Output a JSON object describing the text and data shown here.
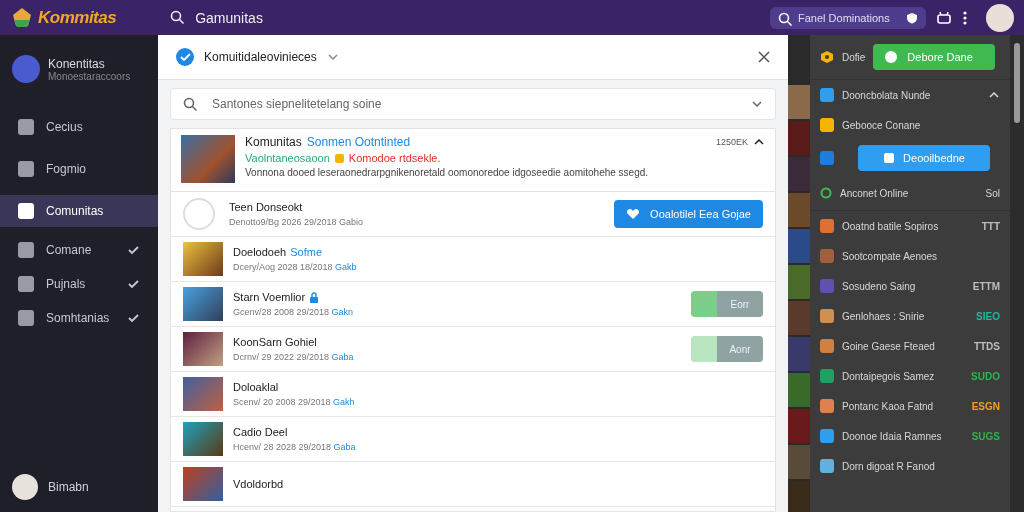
{
  "topbar": {
    "logo": "Kommitas",
    "search": "Gamunitas",
    "quick_search": {
      "placeholder": "Fanel Dominations"
    }
  },
  "sidebar": {
    "profile": {
      "name": "Konentitas",
      "subtitle": "Monoestaraccoors"
    },
    "items": [
      {
        "label": "Cecius",
        "kind": "link",
        "selected": false
      },
      {
        "label": "Fogmio",
        "kind": "link",
        "selected": false
      },
      {
        "label": "Comunitas",
        "kind": "link",
        "selected": true
      },
      {
        "label": "Comane",
        "kind": "group",
        "selected": false
      },
      {
        "label": "Pujnals",
        "kind": "group",
        "selected": false
      },
      {
        "label": "Somhtanias",
        "kind": "group",
        "selected": false
      }
    ],
    "user": "Bimabn"
  },
  "modal": {
    "title": "Komuitidaleovinieces",
    "search": "Santones siepnelitetelang soine",
    "featured": {
      "title": "Komunitas",
      "tag": "Sonmen Ootntinted",
      "status": "Vaolntaneosaoon",
      "warning": "Komodoe rtdsekle.",
      "description": "Vonnona dooed leseraonedrarpgnikenoretald oomonoredoe idgoseedie aomitohehe ssegd.",
      "count": "1250EK",
      "expanded": true
    },
    "rows": [
      {
        "name": "Teen Donseokt",
        "locked": false,
        "subtitle": "Denotto9/Bg 2026 29/2018 Gabio",
        "action": {
          "kind": "primary",
          "label": "Ooalotilel Eea Gojae"
        }
      },
      {
        "name": "Doelodoeh",
        "highlight": "Sofme",
        "locked": false,
        "subtitle": "Dcery/Aog 2028 18/2018",
        "link": "Gakb",
        "action": {
          "kind": "none"
        }
      },
      {
        "name": "Starn Voemlior",
        "locked": true,
        "subtitle": "Gcenv/28 2008 29/2018",
        "link": "Gakn",
        "action": {
          "kind": "toggle",
          "label": "Eorr",
          "on": true
        }
      },
      {
        "name": "KoonSarn Gohiel",
        "locked": false,
        "subtitle": "Dcrnv/ 29 2022 29/2018",
        "link": "Gaba",
        "action": {
          "kind": "toggle",
          "label": "Aonr",
          "on": false
        }
      },
      {
        "name": "Doloaklal",
        "locked": false,
        "subtitle": "Scenv/ 20 2008 29/2018",
        "link": "Gakh",
        "action": {
          "kind": "none"
        }
      },
      {
        "name": "Cadio Deel",
        "locked": false,
        "subtitle": "Hcenv/ 28 2028 29/2018",
        "link": "Gaba",
        "action": {
          "kind": "none"
        }
      },
      {
        "name": "Vdoldorbd",
        "locked": false,
        "action": {
          "kind": "none"
        }
      }
    ]
  },
  "panel": {
    "status_label": "Dofie",
    "status_button": "Debore Dane",
    "section": {
      "title": "Dooncbolata Nunde",
      "expanded": true
    },
    "subsection": "Gebooce Conane",
    "action_button": "Deooilbedne",
    "online": {
      "label": "Anconet Online",
      "value": "Sol"
    },
    "games": [
      {
        "name": "Ooatnd batile Sopiros",
        "value": "TTT",
        "color": "#bdbdbd"
      },
      {
        "name": "Sootcompate Aenoes"
      },
      {
        "name": "Sosudeno Saing",
        "value": "ETTM",
        "color": "#bdbdbd"
      },
      {
        "name": "Genlohaes : Snirie",
        "value": "SIEO",
        "color": "#21b89a"
      },
      {
        "name": "Goine Gaese Fteaed",
        "value": "TTDS",
        "color": "#bdbdbd"
      },
      {
        "name": "Dontaipegois Samez",
        "value": "SUDO",
        "color": "#2fb34a"
      },
      {
        "name": "Pontanc Kaoa Fatnd",
        "value": "ESGN",
        "color": "#f0a020"
      },
      {
        "name": "Doonoe Idaia Ramnes",
        "value": "SUGS",
        "color": "#2fb34a"
      },
      {
        "name": "Dorn digoat R Fanod"
      }
    ]
  }
}
